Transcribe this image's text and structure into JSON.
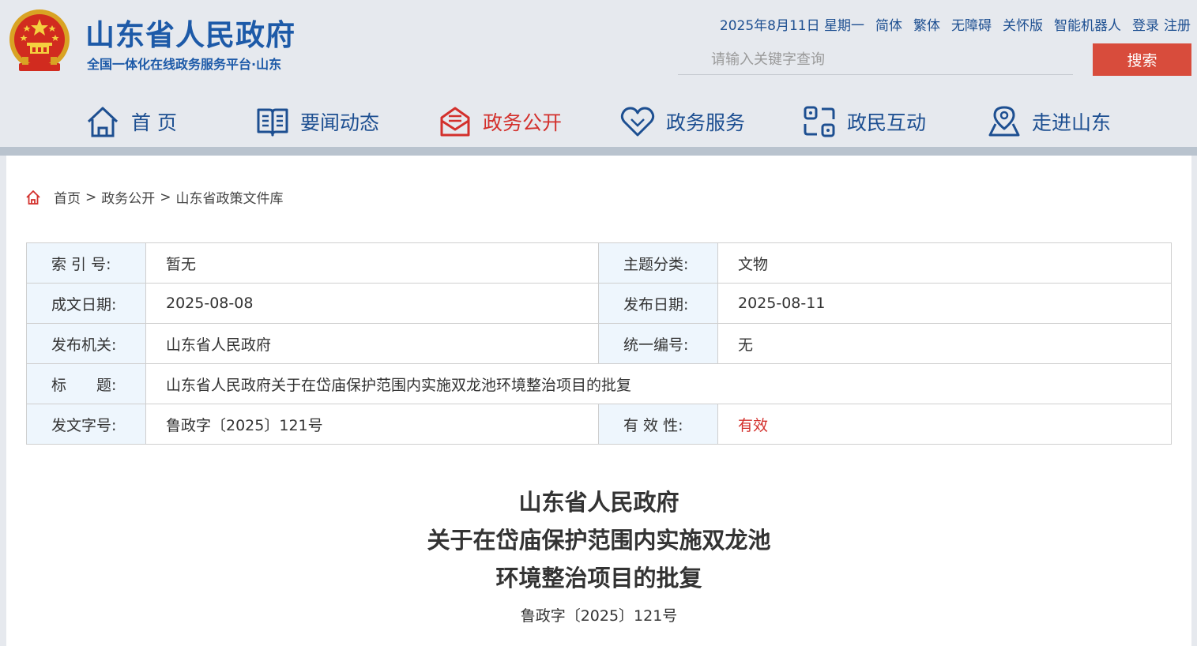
{
  "site": {
    "title": "山东省人民政府",
    "subtitle": "全国一体化在线政务服务平台·山东"
  },
  "topbar": {
    "date": "2025年8月11日 星期一",
    "simplified": "简体",
    "traditional": "繁体",
    "accessible": "无障碍",
    "care": "关怀版",
    "robot": "智能机器人",
    "login": "登录",
    "register": "注册"
  },
  "search": {
    "placeholder": "请输入关键字查询",
    "button": "搜索"
  },
  "nav": [
    {
      "label": "首 页",
      "icon": "home-icon"
    },
    {
      "label": "要闻动态",
      "icon": "book-icon"
    },
    {
      "label": "政务公开",
      "icon": "mail-icon",
      "active": true
    },
    {
      "label": "政务服务",
      "icon": "heart-icon"
    },
    {
      "label": "政民互动",
      "icon": "interaction-icon"
    },
    {
      "label": "走进山东",
      "icon": "map-pin-icon"
    }
  ],
  "breadcrumb": {
    "home": "首页",
    "sep": ">",
    "level1": "政务公开",
    "level2": "山东省政策文件库"
  },
  "meta": {
    "index_label": "索 引 号:",
    "index_value": "暂无",
    "topic_label": "主题分类:",
    "topic_value": "文物",
    "written_label": "成文日期:",
    "written_value": "2025-08-08",
    "published_label": "发布日期:",
    "published_value": "2025-08-11",
    "issuer_label": "发布机关:",
    "issuer_value": "山东省人民政府",
    "serial_label": "统一编号:",
    "serial_value": "无",
    "title_label": "标　　题:",
    "title_value": "山东省人民政府关于在岱庙保护范围内实施双龙池环境整治项目的批复",
    "docno_label": "发文字号:",
    "docno_value": "鲁政字〔2025〕121号",
    "validity_label": "有 效 性:",
    "validity_value": "有效"
  },
  "document": {
    "title_line1": "山东省人民政府",
    "title_line2": "关于在岱庙保护范围内实施双龙池",
    "title_line3": "环境整治项目的批复",
    "number": "鲁政字〔2025〕121号"
  },
  "colors": {
    "brand_blue": "#1d5aa8",
    "nav_blue": "#1d4f91",
    "accent_red": "#d3302c",
    "search_red": "#d84c3c",
    "header_bg": "#e6e9ee",
    "label_bg": "#eef6fd"
  }
}
